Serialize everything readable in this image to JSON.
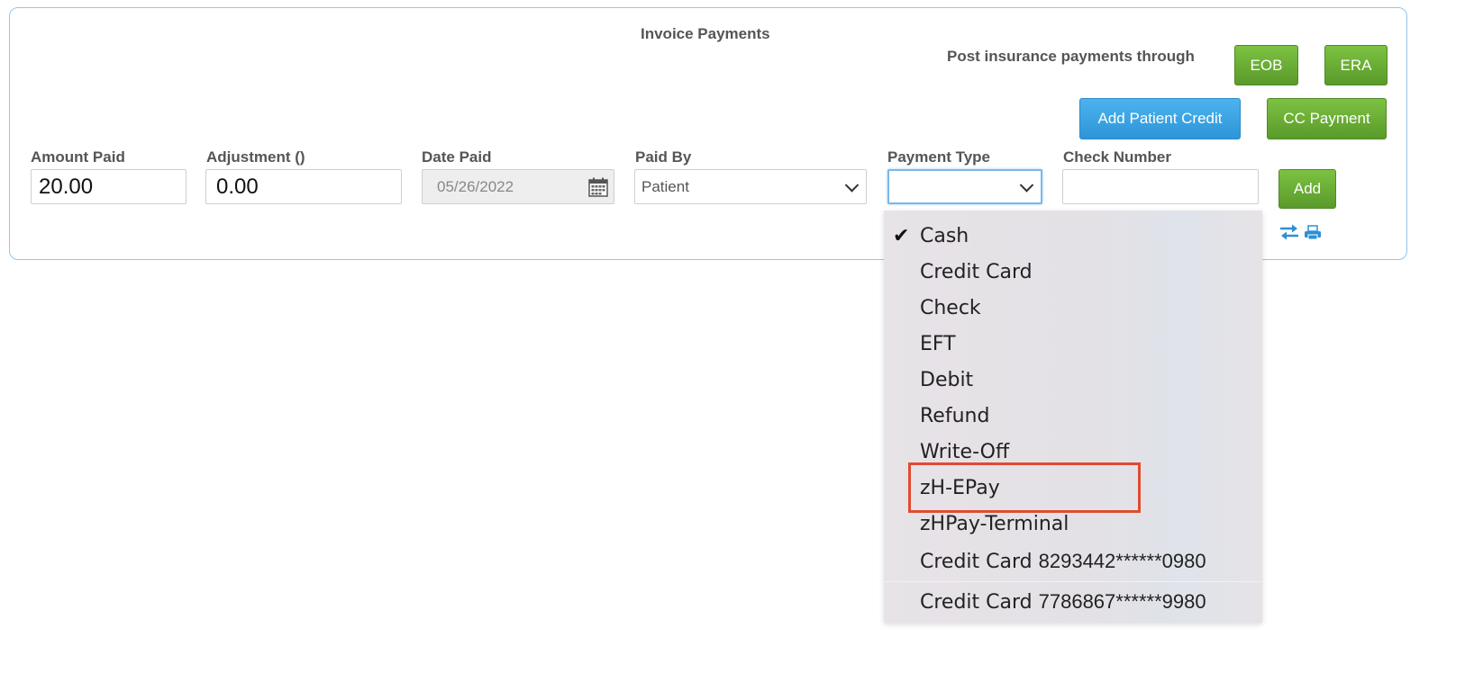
{
  "panel": {
    "title": "Invoice Payments",
    "post_label": "Post insurance payments through",
    "buttons": {
      "eob": "EOB",
      "era": "ERA",
      "add_patient_credit": "Add Patient Credit",
      "cc_payment": "CC Payment",
      "add": "Add"
    }
  },
  "form": {
    "amount_paid": {
      "label": "Amount Paid",
      "value": "20.00"
    },
    "adjustment": {
      "label": "Adjustment ()",
      "value": "0.00"
    },
    "date_paid": {
      "label": "Date Paid",
      "value": "05/26/2022"
    },
    "paid_by": {
      "label": "Paid By",
      "value": "Patient"
    },
    "payment_type": {
      "label": "Payment Type",
      "value": ""
    },
    "check_number": {
      "label": "Check Number",
      "value": ""
    }
  },
  "dropdown": {
    "checked_item": "Cash",
    "highlighted_item": "zH-EPay",
    "items": [
      {
        "label": "Cash"
      },
      {
        "label": "Credit Card"
      },
      {
        "label": "Check"
      },
      {
        "label": "EFT"
      },
      {
        "label": "Debit"
      },
      {
        "label": "Refund"
      },
      {
        "label": "Write-Off"
      },
      {
        "label": "zH-EPay"
      },
      {
        "label": "zHPay-Terminal"
      },
      {
        "label": "Credit Card",
        "number": "8293442******0980"
      },
      {
        "label": "Credit Card",
        "number": "7786867******9980"
      }
    ]
  },
  "icons": [
    "calendar-icon",
    "chevron-down-icon",
    "transfer-icon",
    "printer-icon",
    "checkmark-icon"
  ],
  "colors": {
    "green_button": "#6aae36",
    "blue_button": "#3aa5e6",
    "panel_border": "#8ec9ec",
    "highlight_box": "#e04b30"
  }
}
